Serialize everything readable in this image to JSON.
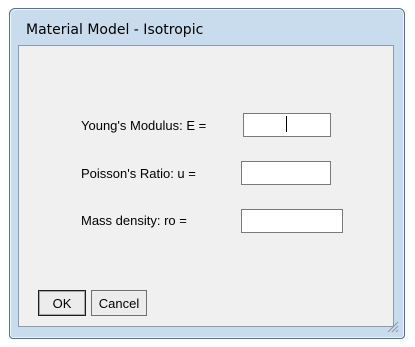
{
  "window": {
    "title": "Material Model - Isotropic"
  },
  "form": {
    "youngs_modulus": {
      "label": "Young's Modulus: E =",
      "value": ""
    },
    "poissons_ratio": {
      "label": "Poisson's Ratio: u =",
      "value": ""
    },
    "mass_density": {
      "label": "Mass density: ro =",
      "value": ""
    }
  },
  "buttons": {
    "ok_label": "OK",
    "cancel_label": "Cancel"
  },
  "icons": {
    "resize_grip": "resize-grip-icon"
  }
}
